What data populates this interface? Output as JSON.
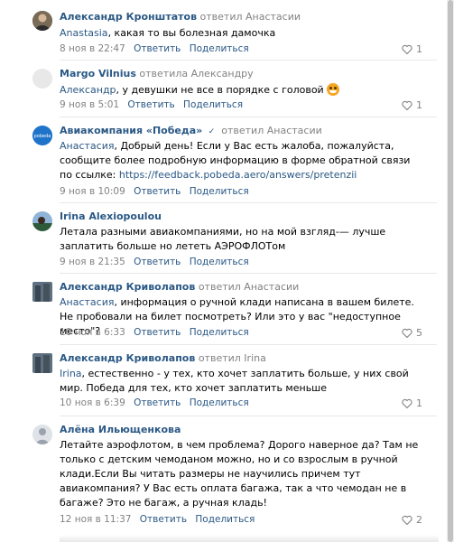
{
  "comments": [
    {
      "author": "Александр Кронштатов",
      "replied": "ответил Анастасии",
      "mention": "Anastasia",
      "text": ", какая то вы болезная дамочка",
      "date": "8 ноя в 22:47",
      "reply": "Ответить",
      "share": "Поделиться",
      "likes": "1"
    },
    {
      "author": "Margo Vilnius",
      "replied": "ответила Александру",
      "mention": "Александр",
      "text": ", у девушки не все в порядке с головой",
      "date": "9 ноя в 5:01",
      "reply": "Ответить",
      "share": "Поделиться",
      "likes": "1"
    },
    {
      "author": "Авиакомпания «Победа»",
      "replied": "ответил Анастасии",
      "mention": "Анастасия",
      "text": ", Добрый день! Если у Вас есть жалоба, пожалуйста, сообщите более подробную информацию в форме обратной связи по ссылке: ",
      "link": "https://feedback.pobeda.aero/answers/pretenzii",
      "date": "9 ноя в 10:09",
      "reply": "Ответить",
      "share": "Поделиться",
      "avatar_text": "pobeda"
    },
    {
      "author": "Irina Alexiopoulou",
      "text": "Летала разными авиакомпаниями, но на мой взгляд-— лучше заплатить больше но лететь АЭРОФЛОТом",
      "date": "9 ноя в 21:35",
      "reply": "Ответить",
      "share": "Поделиться"
    },
    {
      "author": "Александр Криволапов",
      "replied": "ответил Анастасии",
      "mention": "Анастасия",
      "text": ", информация о ручной клади написана в вашем билете. Не пробовали на билет посмотреть? Или это у вас \"недоступное место\"?",
      "date": "10 ноя в 6:33",
      "reply": "Ответить",
      "share": "Поделиться",
      "likes": "5"
    },
    {
      "author": "Александр Криволапов",
      "replied": "ответил Irina",
      "mention": "Irina",
      "text": ", естественно - у тех, кто хочет заплатить больше, у них свой мир. Победа для тех, кто хочет заплатить меньше",
      "date": "10 ноя в 6:39",
      "reply": "Ответить",
      "share": "Поделиться",
      "likes": "1"
    },
    {
      "author": "Алёна Ильющенкова",
      "text": "Летайте аэрофлотом, в чем проблема? Дорого наверное да? Там не только с детским чемоданом можно, но и со взрослым в ручной клади.Если Вы читать размеры не научились причем тут авиакомпания? У Вас есть оплата багажа, так а что чемодан не в багаже? Это не багаж, а ручная кладь!",
      "date": "12 ноя в 11:37",
      "reply": "Ответить",
      "share": "Поделиться",
      "likes": "2"
    }
  ],
  "colors": {
    "link": "#2a5885",
    "muted": "#828282",
    "separator": "#e7e8ec"
  }
}
